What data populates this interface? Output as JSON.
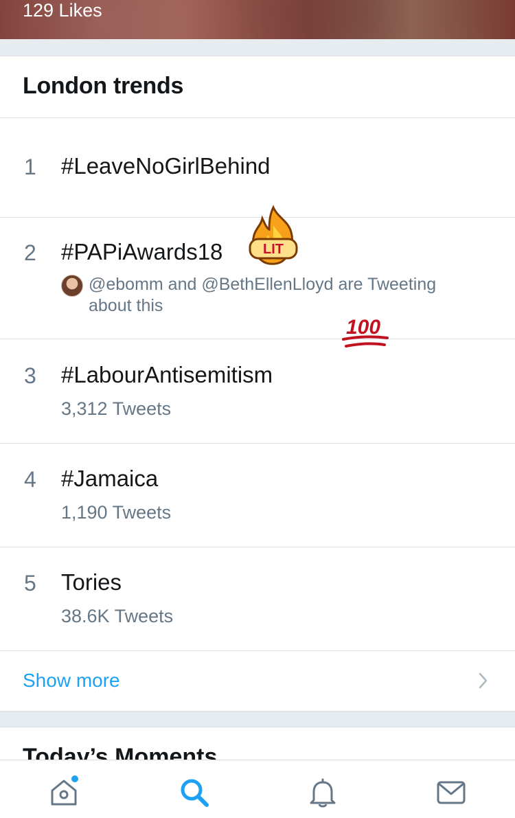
{
  "header": {
    "likes_text": "129 Likes"
  },
  "trends": {
    "title": "London trends",
    "items": [
      {
        "rank": "1",
        "name": "#LeaveNoGirlBehind",
        "meta": ""
      },
      {
        "rank": "2",
        "name": "#PAPiAwards18",
        "context": "@ebomm and @BethEllenLloyd are Tweeting about this"
      },
      {
        "rank": "3",
        "name": "#LabourAntisemitism",
        "meta": "3,312 Tweets"
      },
      {
        "rank": "4",
        "name": "#Jamaica",
        "meta": "1,190 Tweets"
      },
      {
        "rank": "5",
        "name": "Tories",
        "meta": "38.6K Tweets"
      }
    ],
    "show_more": "Show more"
  },
  "stickers": {
    "lit_label": "LIT",
    "hundred_label": "100"
  },
  "moments": {
    "title": "Today’s Moments"
  },
  "tabbar": {
    "items": [
      {
        "icon": "home-icon",
        "active": false,
        "notification_dot": true
      },
      {
        "icon": "search-icon",
        "active": true
      },
      {
        "icon": "bell-icon",
        "active": false
      },
      {
        "icon": "mail-icon",
        "active": false
      }
    ]
  },
  "colors": {
    "accent": "#1da1f2",
    "secondary_text": "#657786",
    "primary_text": "#14171a"
  }
}
